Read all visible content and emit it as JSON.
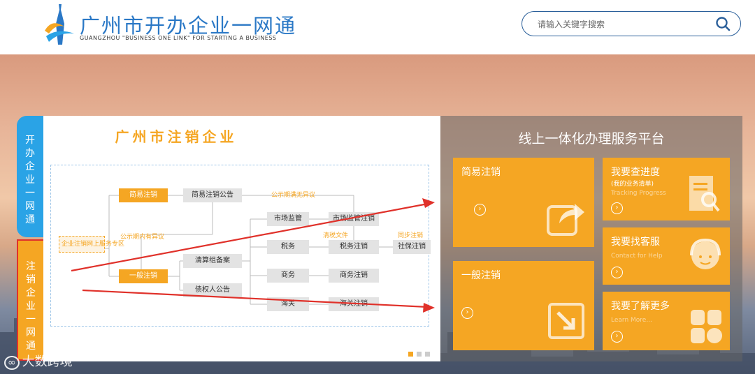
{
  "header": {
    "title": "广州市开办企业一网通",
    "subtitle": "GUANGZHOU \"BUSINESS ONE LINK\" FOR STARTING A BUSINESS",
    "search_placeholder": "请输入关键字搜索",
    "search_icon": "search-icon"
  },
  "side_tabs": [
    {
      "label": "开办企业一网通",
      "chars": [
        "开",
        "办",
        "企",
        "业",
        "一",
        "网",
        "通"
      ]
    },
    {
      "label": "注销企业一网通",
      "chars": [
        "注",
        "销",
        "企",
        "业",
        "一",
        "网",
        "通"
      ]
    }
  ],
  "diagram": {
    "title": "广州市注销企业",
    "entry": "企业注销网上服务专区",
    "simple": "简易注销",
    "simple_notice": "简易注销公告",
    "no_objection": "公示期满无异议",
    "has_objection": "公示期内有异议",
    "general": "一般注销",
    "liquidation": "清算组备案",
    "creditor": "债权人公告",
    "market": "市场监管",
    "market_dereg": "市场监管注销",
    "tax_docs": "清税文件",
    "tax": "税务",
    "tax_dereg": "税务注销",
    "sync_dereg": "同步注销",
    "social_dereg": "社保注销",
    "commerce": "商务",
    "commerce_dereg": "商务注销",
    "customs": "海关",
    "customs_dereg": "海关注销"
  },
  "panel": {
    "title": "线上一体化办理服务平台",
    "cards": [
      {
        "title": "简易注销",
        "sub1": "",
        "sub2": "",
        "icon": "share-icon"
      },
      {
        "title": "我要查进度",
        "sub1": "(我的业务清单)",
        "sub2": "Tracking Progress",
        "icon": "document-search-icon"
      },
      {
        "title": "我要找客服",
        "sub1": "",
        "sub2": "Contact for Help",
        "icon": "customer-service-icon"
      },
      {
        "title": "一般注销",
        "sub1": "",
        "sub2": "",
        "icon": "download-arrow-icon"
      },
      {
        "title": "我要了解更多",
        "sub1": "",
        "sub2": "Learn More...",
        "icon": "grid-icon"
      }
    ]
  },
  "watermark": "大数跨境",
  "colors": {
    "accent": "#f5a623",
    "blue": "#2aa3e6",
    "annotation": "#e0312a"
  }
}
